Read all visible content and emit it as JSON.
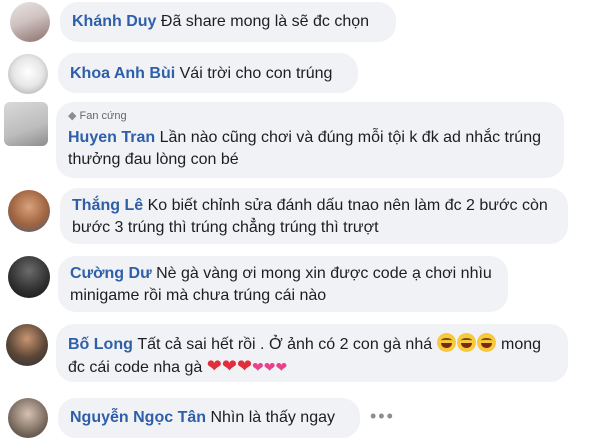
{
  "comments": [
    {
      "name": "Khánh Duy",
      "lines": [
        "Đã share mong là sẽ đc chọn"
      ]
    },
    {
      "name": "Khoa Anh Bùi",
      "lines": [
        "Vái trời cho con trúng"
      ]
    },
    {
      "badge": "Fan cứng",
      "name": "Huyen Tran",
      "lines": [
        "Lần nào cũng chơi và đúng mỗi tội k đk ad nhắc trúng",
        "thưởng đau lòng con bé"
      ]
    },
    {
      "name": "Thắng Lê",
      "lines": [
        "Ko biết chỉnh sửa đánh dấu tnao nên làm đc 2 bước còn",
        "bước 3 trúng thì trúng chẳng trúng thì trượt"
      ]
    },
    {
      "name": "Cường Dư",
      "lines": [
        "Nè gà vàng ơi mong xin được code ạ chơi nhìu",
        "minigame rồi mà chưa trúng cái nào"
      ]
    },
    {
      "name": "Bố Long",
      "lines": [
        "Tất cả sai hết rồi . Ở ảnh có 2 con gà nhá",
        "đc cái code nha gà"
      ],
      "line1_tail": "mong"
    },
    {
      "name": "Nguyễn Ngọc Tân",
      "lines": [
        "Nhìn là thấy ngay"
      ],
      "more": "•••"
    }
  ],
  "icons": {
    "badge": "diamond-icon",
    "laugh": "laughing-emoji",
    "heart": "red-heart-emoji",
    "hearts": "pink-hearts-emoji",
    "more": "more-options-icon"
  },
  "colors": {
    "bubble": "#f0f2f5",
    "name": "#2f5fa8",
    "text": "#1c1e21"
  }
}
